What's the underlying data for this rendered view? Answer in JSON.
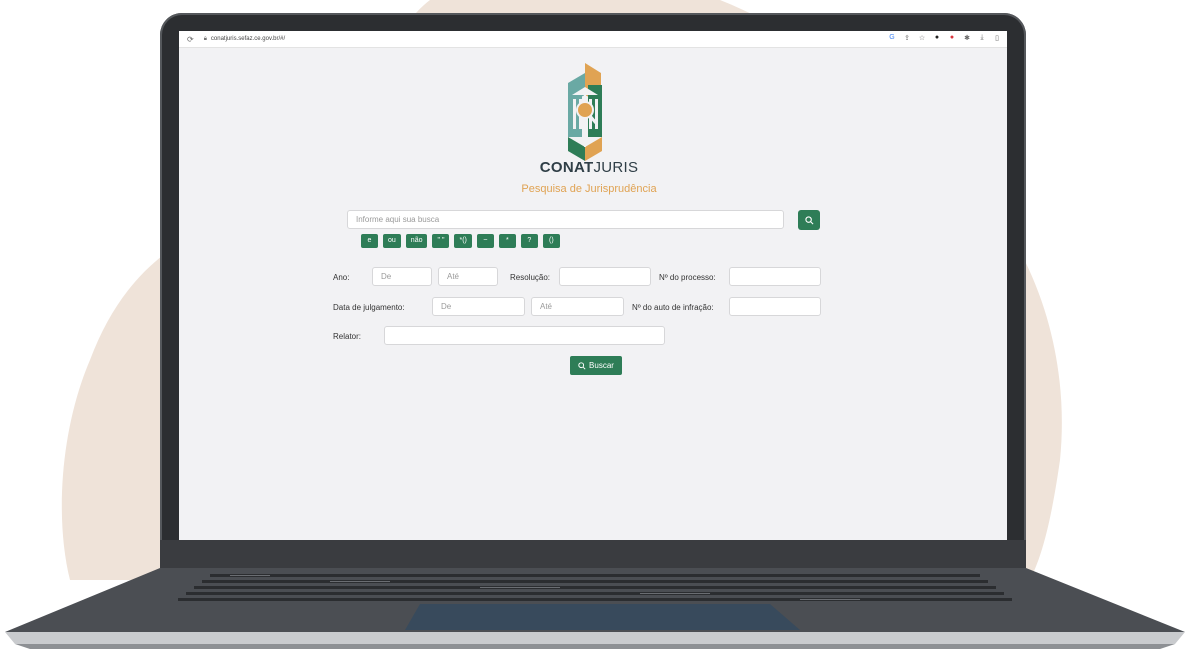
{
  "browser": {
    "url": "conatjuris.sefaz.ce.gov.br/#/"
  },
  "brand": {
    "bold": "CONAT",
    "light": "JURIS",
    "subtitle": "Pesquisa de Jurisprudência"
  },
  "search": {
    "placeholder": "Informe aqui sua busca"
  },
  "operators": [
    "e",
    "ou",
    "não",
    "\" \"",
    "*()",
    "~",
    "*",
    "?",
    "()"
  ],
  "form": {
    "ano_label": "Ano:",
    "de_placeholder": "De",
    "ate_placeholder": "Até",
    "resolucao_label": "Resolução:",
    "processo_label": "Nº do processo:",
    "julgamento_label": "Data de julgamento:",
    "auto_label": "Nº do auto de infração:",
    "relator_label": "Relator:"
  },
  "buscar_label": "Buscar",
  "colors": {
    "primary": "#2e7d57",
    "accent": "#e0a353",
    "blob": "#efe3d9"
  }
}
